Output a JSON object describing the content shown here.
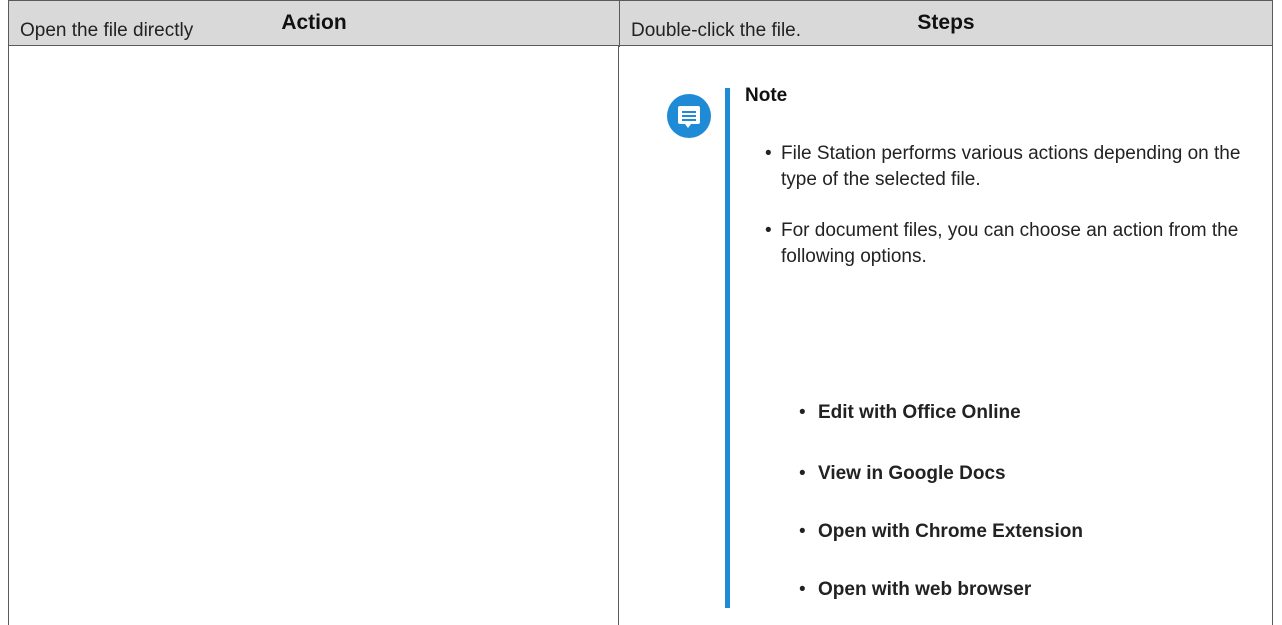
{
  "table": {
    "header": {
      "action": "Action",
      "steps": "Steps"
    },
    "row": {
      "action": "Open the file directly",
      "steps_intro": "Double-click the file.",
      "note": {
        "icon": "note-icon",
        "accent_color": "#1f8ad6",
        "title": "Note",
        "items": [
          "File Station performs various actions depending on the type of the selected file.",
          "For document files, you can choose an action from the following options."
        ],
        "options": [
          "Edit with Office Online",
          "View in Google Docs",
          "Open with Chrome Extension",
          "Open with web browser"
        ]
      }
    }
  }
}
